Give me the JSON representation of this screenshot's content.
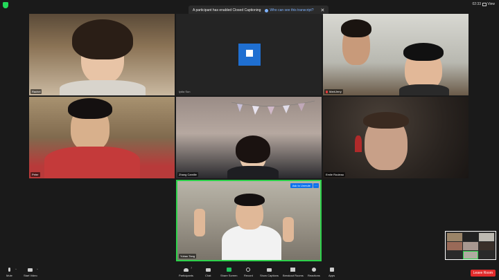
{
  "banner": {
    "message": "A participant has enabled Closed Captioning",
    "link": "Who can see this transcript?",
    "close": "✕"
  },
  "clock": "02:33",
  "view_label": "View",
  "participants": [
    {
      "name": "Rachel",
      "muted": false
    },
    {
      "name": "lydia Sun",
      "muted": false
    },
    {
      "name": "MarkJerry",
      "muted": true
    },
    {
      "name": "Peter",
      "muted": false
    },
    {
      "name": "Zhang Camille",
      "muted": false
    },
    {
      "name": "Emile Rouleau",
      "muted": false
    },
    {
      "name": "Yuhao Tang",
      "muted": false
    }
  ],
  "unmute": {
    "label": "Ask to Unmute",
    "more": "···"
  },
  "toolbar": {
    "mute": "Mute",
    "start_video": "Start Video",
    "participants": "Participants",
    "participants_count": "7",
    "chat": "Chat",
    "share_screen": "Share Screen",
    "record": "Record",
    "show_captions": "Show Captions",
    "breakout_rooms": "Breakout Rooms",
    "reactions": "Reactions",
    "apps": "Apps",
    "leave": "Leave Room"
  },
  "colors": {
    "active_speaker": "#2cd24a",
    "accent": "#0e72ed",
    "leave": "#e02b2b"
  }
}
